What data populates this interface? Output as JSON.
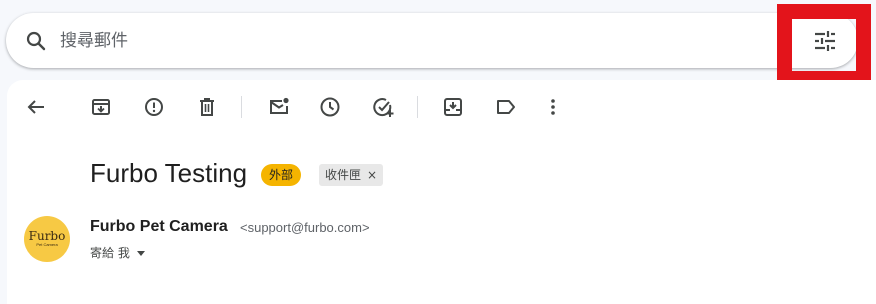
{
  "search": {
    "placeholder": "搜尋郵件",
    "search_icon": "search-icon",
    "filter_icon": "tune-filter-icon",
    "highlight_color": "#e3141b"
  },
  "toolbar": {
    "icons": [
      "back-arrow-icon",
      "archive-icon",
      "report-spam-icon",
      "delete-icon",
      "mark-unread-icon",
      "snooze-icon",
      "add-to-tasks-icon",
      "move-to-icon",
      "label-icon",
      "more-options-icon"
    ]
  },
  "email": {
    "subject": "Furbo Testing",
    "labels": [
      {
        "text": "外部",
        "color": "#f5b400"
      },
      {
        "text": "收件匣",
        "color": "#e8e8e8",
        "removable": true
      }
    ],
    "label_close_symbol": "×",
    "sender": {
      "name": "Furbo Pet Camera",
      "email": "<support@furbo.com>",
      "avatar_brand": "Furbo",
      "avatar_sub": "Pet Camera",
      "avatar_color": "#f7c944"
    },
    "recipients_text": "寄給 我",
    "recipients_caret_icon": "caret-down-icon"
  }
}
